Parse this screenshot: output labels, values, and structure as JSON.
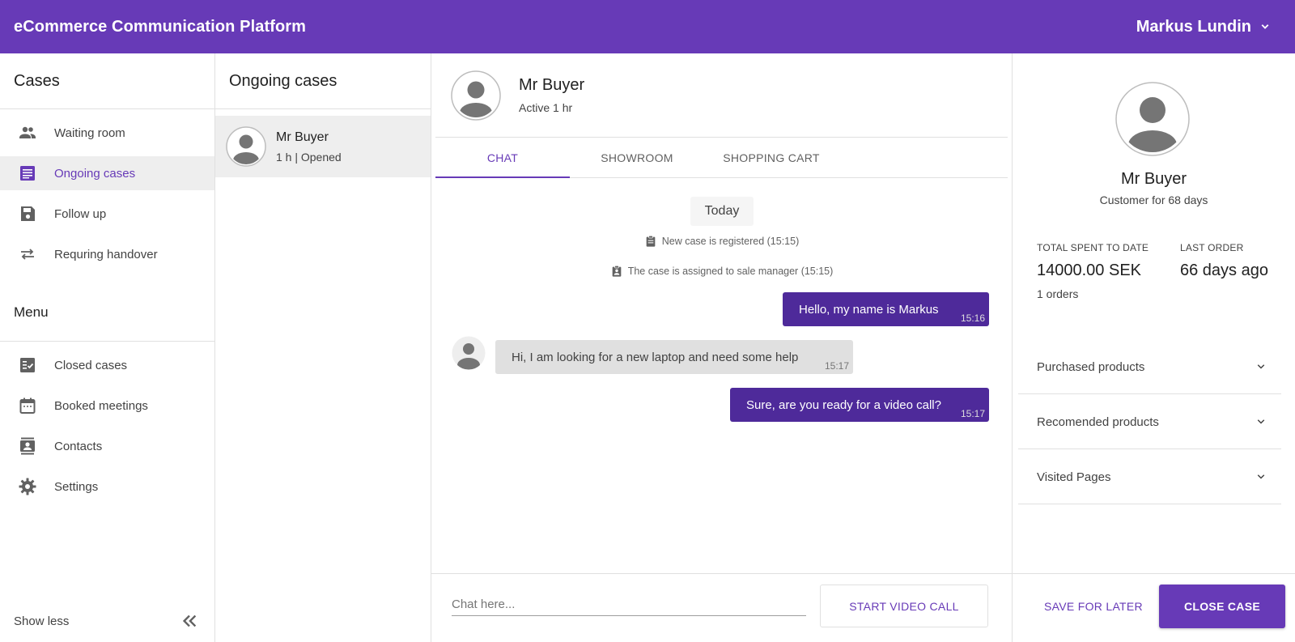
{
  "app": {
    "title": "eCommerce Communication Platform",
    "user_name": "Markus Lundin"
  },
  "colors": {
    "primary": "#673ab7",
    "outgoing_bubble": "#4e2a9a",
    "incoming_bubble": "#e0e0e0"
  },
  "sidebar": {
    "cases_title": "Cases",
    "cases_items": [
      {
        "label": "Waiting room",
        "icon": "people-icon"
      },
      {
        "label": "Ongoing cases",
        "icon": "list-icon",
        "active": true
      },
      {
        "label": "Follow up",
        "icon": "save-icon"
      },
      {
        "label": "Requring handover",
        "icon": "swap-arrows-icon"
      }
    ],
    "menu_title": "Menu",
    "menu_items": [
      {
        "label": "Closed cases",
        "icon": "checklist-icon"
      },
      {
        "label": "Booked meetings",
        "icon": "calendar-icon"
      },
      {
        "label": "Contacts",
        "icon": "contacts-icon"
      },
      {
        "label": "Settings",
        "icon": "gear-icon"
      }
    ],
    "show_less": "Show less"
  },
  "cases_column": {
    "title": "Ongoing cases",
    "items": [
      {
        "name": "Mr Buyer",
        "sub": "1 h | Opened"
      }
    ]
  },
  "chat": {
    "name": "Mr Buyer",
    "status": "Active 1 hr",
    "tabs": [
      "CHAT",
      "SHOWROOM",
      "SHOPPING CART"
    ],
    "active_tab": 0,
    "date_chip": "Today",
    "system_messages": [
      "New case is registered (15:15)",
      "The case is assigned to sale manager (15:15)"
    ],
    "messages": [
      {
        "direction": "out",
        "text": "Hello, my name is Markus",
        "time": "15:16"
      },
      {
        "direction": "in",
        "text": "Hi, I am looking for a new laptop and need some help",
        "time": "15:17"
      },
      {
        "direction": "out",
        "text": "Sure, are you ready for a video call?",
        "time": "15:17"
      }
    ],
    "input_placeholder": "Chat here...",
    "video_button": "START VIDEO CALL"
  },
  "customer": {
    "name": "Mr Buyer",
    "since": "Customer for 68 days",
    "total_label": "TOTAL SPENT TO DATE",
    "total_value": "14000.00 SEK",
    "orders": "1 orders",
    "last_order_label": "LAST ORDER",
    "last_order_value": "66 days ago",
    "accordions": [
      "Purchased products",
      "Recomended products",
      "Visited Pages"
    ],
    "save_button": "SAVE FOR LATER",
    "close_button": "CLOSE CASE"
  }
}
